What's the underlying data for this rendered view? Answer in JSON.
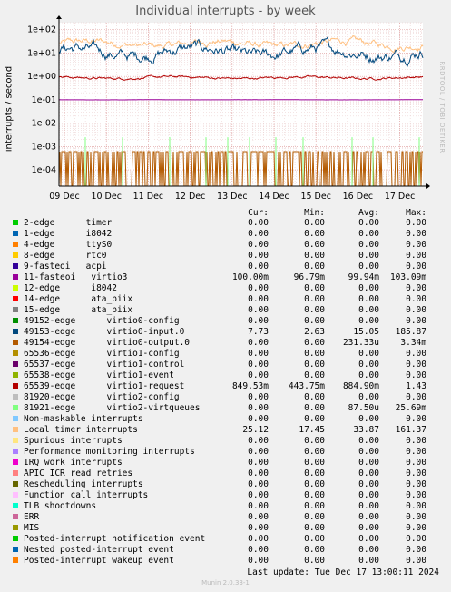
{
  "page": {
    "title": "Individual interrupts - by week",
    "watermark": "RRDTOOL / TOBI OETIKER",
    "last_update": "Last update:  Tue Dec 17 13:00:11 2024",
    "munin_version": "Munin 2.0.33-1"
  },
  "legend_header": {
    "cur": "Cur:",
    "min": "Min:",
    "avg": "Avg:",
    "max": "Max:"
  },
  "legend": [
    {
      "label": "2-edge      timer",
      "color": "#00cc00",
      "cur": "0.00",
      "min": "0.00",
      "avg": "0.00",
      "max": "0.00"
    },
    {
      "label": "1-edge      i8042",
      "color": "#0066b3",
      "cur": "0.00",
      "min": "0.00",
      "avg": "0.00",
      "max": "0.00"
    },
    {
      "label": "4-edge      ttyS0",
      "color": "#ff8000",
      "cur": "0.00",
      "min": "0.00",
      "avg": "0.00",
      "max": "0.00"
    },
    {
      "label": "8-edge      rtc0",
      "color": "#ffcc00",
      "cur": "0.00",
      "min": "0.00",
      "avg": "0.00",
      "max": "0.00"
    },
    {
      "label": "9-fasteoi   acpi",
      "color": "#330099",
      "cur": "0.00",
      "min": "0.00",
      "avg": "0.00",
      "max": "0.00"
    },
    {
      "label": "11-fasteoi   virtio3",
      "color": "#990099",
      "cur": "100.00m",
      "min": "96.79m",
      "avg": "99.94m",
      "max": "103.09m"
    },
    {
      "label": "12-edge      i8042",
      "color": "#ccff00",
      "cur": "0.00",
      "min": "0.00",
      "avg": "0.00",
      "max": "0.00"
    },
    {
      "label": "14-edge      ata_piix",
      "color": "#ff0000",
      "cur": "0.00",
      "min": "0.00",
      "avg": "0.00",
      "max": "0.00"
    },
    {
      "label": "15-edge      ata_piix",
      "color": "#808080",
      "cur": "0.00",
      "min": "0.00",
      "avg": "0.00",
      "max": "0.00"
    },
    {
      "label": "49152-edge      virtio0-config",
      "color": "#008f00",
      "cur": "0.00",
      "min": "0.00",
      "avg": "0.00",
      "max": "0.00"
    },
    {
      "label": "49153-edge      virtio0-input.0",
      "color": "#00487d",
      "cur": "7.73",
      "min": "2.63",
      "avg": "15.05",
      "max": "185.87"
    },
    {
      "label": "49154-edge      virtio0-output.0",
      "color": "#b35a00",
      "cur": "0.00",
      "min": "0.00",
      "avg": "231.33u",
      "max": "3.34m"
    },
    {
      "label": "65536-edge      virtio1-config",
      "color": "#b38f00",
      "cur": "0.00",
      "min": "0.00",
      "avg": "0.00",
      "max": "0.00"
    },
    {
      "label": "65537-edge      virtio1-control",
      "color": "#6b006b",
      "cur": "0.00",
      "min": "0.00",
      "avg": "0.00",
      "max": "0.00"
    },
    {
      "label": "65538-edge      virtio1-event",
      "color": "#8fb300",
      "cur": "0.00",
      "min": "0.00",
      "avg": "0.00",
      "max": "0.00"
    },
    {
      "label": "65539-edge      virtio1-request",
      "color": "#b30000",
      "cur": "849.53m",
      "min": "443.75m",
      "avg": "884.90m",
      "max": "1.43"
    },
    {
      "label": "81920-edge      virtio2-config",
      "color": "#bebebe",
      "cur": "0.00",
      "min": "0.00",
      "avg": "0.00",
      "max": "0.00"
    },
    {
      "label": "81921-edge      virtio2-virtqueues",
      "color": "#80ff80",
      "cur": "0.00",
      "min": "0.00",
      "avg": "87.50u",
      "max": "25.69m"
    },
    {
      "label": "Non-maskable interrupts",
      "color": "#80c9ff",
      "cur": "0.00",
      "min": "0.00",
      "avg": "0.00",
      "max": "0.00"
    },
    {
      "label": "Local timer interrupts",
      "color": "#ffc080",
      "cur": "25.12",
      "min": "17.45",
      "avg": "33.87",
      "max": "161.37"
    },
    {
      "label": "Spurious interrupts",
      "color": "#ffe680",
      "cur": "0.00",
      "min": "0.00",
      "avg": "0.00",
      "max": "0.00"
    },
    {
      "label": "Performance monitoring interrupts",
      "color": "#aa80ff",
      "cur": "0.00",
      "min": "0.00",
      "avg": "0.00",
      "max": "0.00"
    },
    {
      "label": "IRQ work interrupts",
      "color": "#ee00cc",
      "cur": "0.00",
      "min": "0.00",
      "avg": "0.00",
      "max": "0.00"
    },
    {
      "label": "APIC ICR read retries",
      "color": "#ff8080",
      "cur": "0.00",
      "min": "0.00",
      "avg": "0.00",
      "max": "0.00"
    },
    {
      "label": "Rescheduling interrupts",
      "color": "#666600",
      "cur": "0.00",
      "min": "0.00",
      "avg": "0.00",
      "max": "0.00"
    },
    {
      "label": "Function call interrupts",
      "color": "#ffbfff",
      "cur": "0.00",
      "min": "0.00",
      "avg": "0.00",
      "max": "0.00"
    },
    {
      "label": "TLB shootdowns",
      "color": "#00ffcc",
      "cur": "0.00",
      "min": "0.00",
      "avg": "0.00",
      "max": "0.00"
    },
    {
      "label": "ERR",
      "color": "#cc6699",
      "cur": "0.00",
      "min": "0.00",
      "avg": "0.00",
      "max": "0.00"
    },
    {
      "label": "MIS",
      "color": "#999900",
      "cur": "0.00",
      "min": "0.00",
      "avg": "0.00",
      "max": "0.00"
    },
    {
      "label": "Posted-interrupt notification event",
      "color": "#00cc00",
      "cur": "0.00",
      "min": "0.00",
      "avg": "0.00",
      "max": "0.00"
    },
    {
      "label": "Nested posted-interrupt event",
      "color": "#0066b3",
      "cur": "0.00",
      "min": "0.00",
      "avg": "0.00",
      "max": "0.00"
    },
    {
      "label": "Posted-interrupt wakeup event",
      "color": "#ff8000",
      "cur": "0.00",
      "min": "0.00",
      "avg": "0.00",
      "max": "0.00"
    }
  ],
  "chart_data": {
    "type": "line",
    "title": "Individual interrupts - by week",
    "ylabel": "interrupts / second",
    "yscale": "log",
    "ylim": [
      2e-05,
      200
    ],
    "yticks": [
      {
        "value": 100,
        "label": "1e+02"
      },
      {
        "value": 10,
        "label": "1e+01"
      },
      {
        "value": 1,
        "label": "1e+00"
      },
      {
        "value": 0.1,
        "label": "1e-01"
      },
      {
        "value": 0.01,
        "label": "1e-02"
      },
      {
        "value": 0.001,
        "label": "1e-03"
      },
      {
        "value": 0.0001,
        "label": "1e-04"
      }
    ],
    "x_range_days": [
      8.87,
      17.55
    ],
    "xticks": [
      {
        "value": 9,
        "label": "09 Dec"
      },
      {
        "value": 10,
        "label": "10 Dec"
      },
      {
        "value": 11,
        "label": "11 Dec"
      },
      {
        "value": 12,
        "label": "12 Dec"
      },
      {
        "value": 13,
        "label": "13 Dec"
      },
      {
        "value": 14,
        "label": "14 Dec"
      },
      {
        "value": 15,
        "label": "15 Dec"
      },
      {
        "value": 16,
        "label": "16 Dec"
      },
      {
        "value": 17,
        "label": "17 Dec"
      }
    ],
    "grid": true,
    "series": [
      {
        "name": "Local timer interrupts",
        "color": "#ffc080",
        "kind": "line",
        "level": 25,
        "jitter": 0.18
      },
      {
        "name": "49153-edge      virtio0-input.0",
        "color": "#00487d",
        "kind": "line",
        "level": 11,
        "jitter": 0.3
      },
      {
        "name": "65539-edge      virtio1-request",
        "color": "#b30000",
        "kind": "line",
        "level": 0.88,
        "jitter": 0.06
      },
      {
        "name": "11-fasteoi   virtio3",
        "color": "#990099",
        "kind": "line",
        "level": 0.1,
        "jitter": 0.003
      },
      {
        "name": "49154-edge      virtio0-output.0",
        "color": "#b35a00",
        "kind": "spikes",
        "level": 0.0006,
        "low": 2e-05
      },
      {
        "name": "81921-edge      virtio2-virtqueues",
        "color": "#80ff80",
        "kind": "rare_spikes",
        "level": 0.0025,
        "low": 2e-05
      }
    ]
  }
}
